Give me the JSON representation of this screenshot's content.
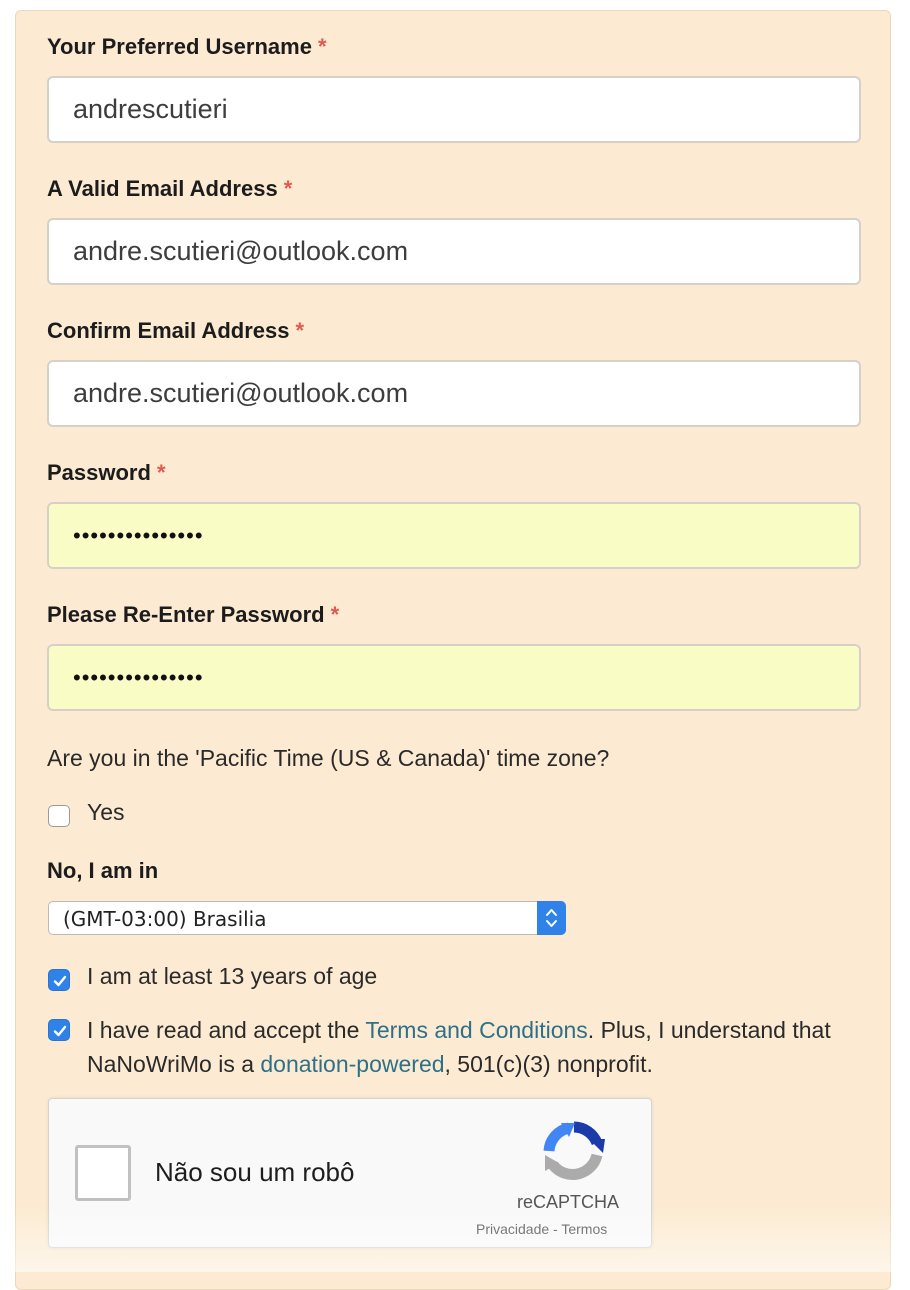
{
  "form": {
    "username": {
      "label": "Your Preferred Username",
      "required_mark": "*",
      "value": "andrescutieri"
    },
    "email": {
      "label": "A Valid Email Address",
      "required_mark": "*",
      "value": "andre.scutieri@outlook.com"
    },
    "confirm_email": {
      "label": "Confirm Email Address",
      "required_mark": "*",
      "value": "andre.scutieri@outlook.com"
    },
    "password": {
      "label": "Password",
      "required_mark": "*",
      "value": "•••••••••••••••"
    },
    "password_confirm": {
      "label": "Please Re-Enter Password",
      "required_mark": "*",
      "value": "•••••••••••••••"
    },
    "timezone_question": "Are you in the 'Pacific Time (US & Canada)' time zone?",
    "yes_label": "Yes",
    "yes_checked": false,
    "no_label": "No, I am in",
    "timezone_selected": "(GMT-03:00) Brasilia",
    "age_label": "I am at least 13 years of age",
    "age_checked": true,
    "terms": {
      "checked": true,
      "prefix": "I have read and accept the ",
      "terms_link": "Terms and Conditions",
      "middle": ". Plus, I understand that NaNoWriMo is a ",
      "donation_link": "donation-powered",
      "suffix": ", 501(c)(3) nonprofit."
    }
  },
  "recaptcha": {
    "label": "Não sou um robô",
    "brand": "reCAPTCHA",
    "privacy": "Privacidade",
    "separator": " - ",
    "terms": "Termos"
  },
  "colors": {
    "panel_background": "#fcebd2",
    "required_star": "#e05a50",
    "autofill_background": "#fafcc6",
    "checkbox_checked": "#2f83e8",
    "link": "#2e7088"
  },
  "icons": [
    "checkmark-icon",
    "select-arrows-icon",
    "recaptcha-logo-icon"
  ]
}
